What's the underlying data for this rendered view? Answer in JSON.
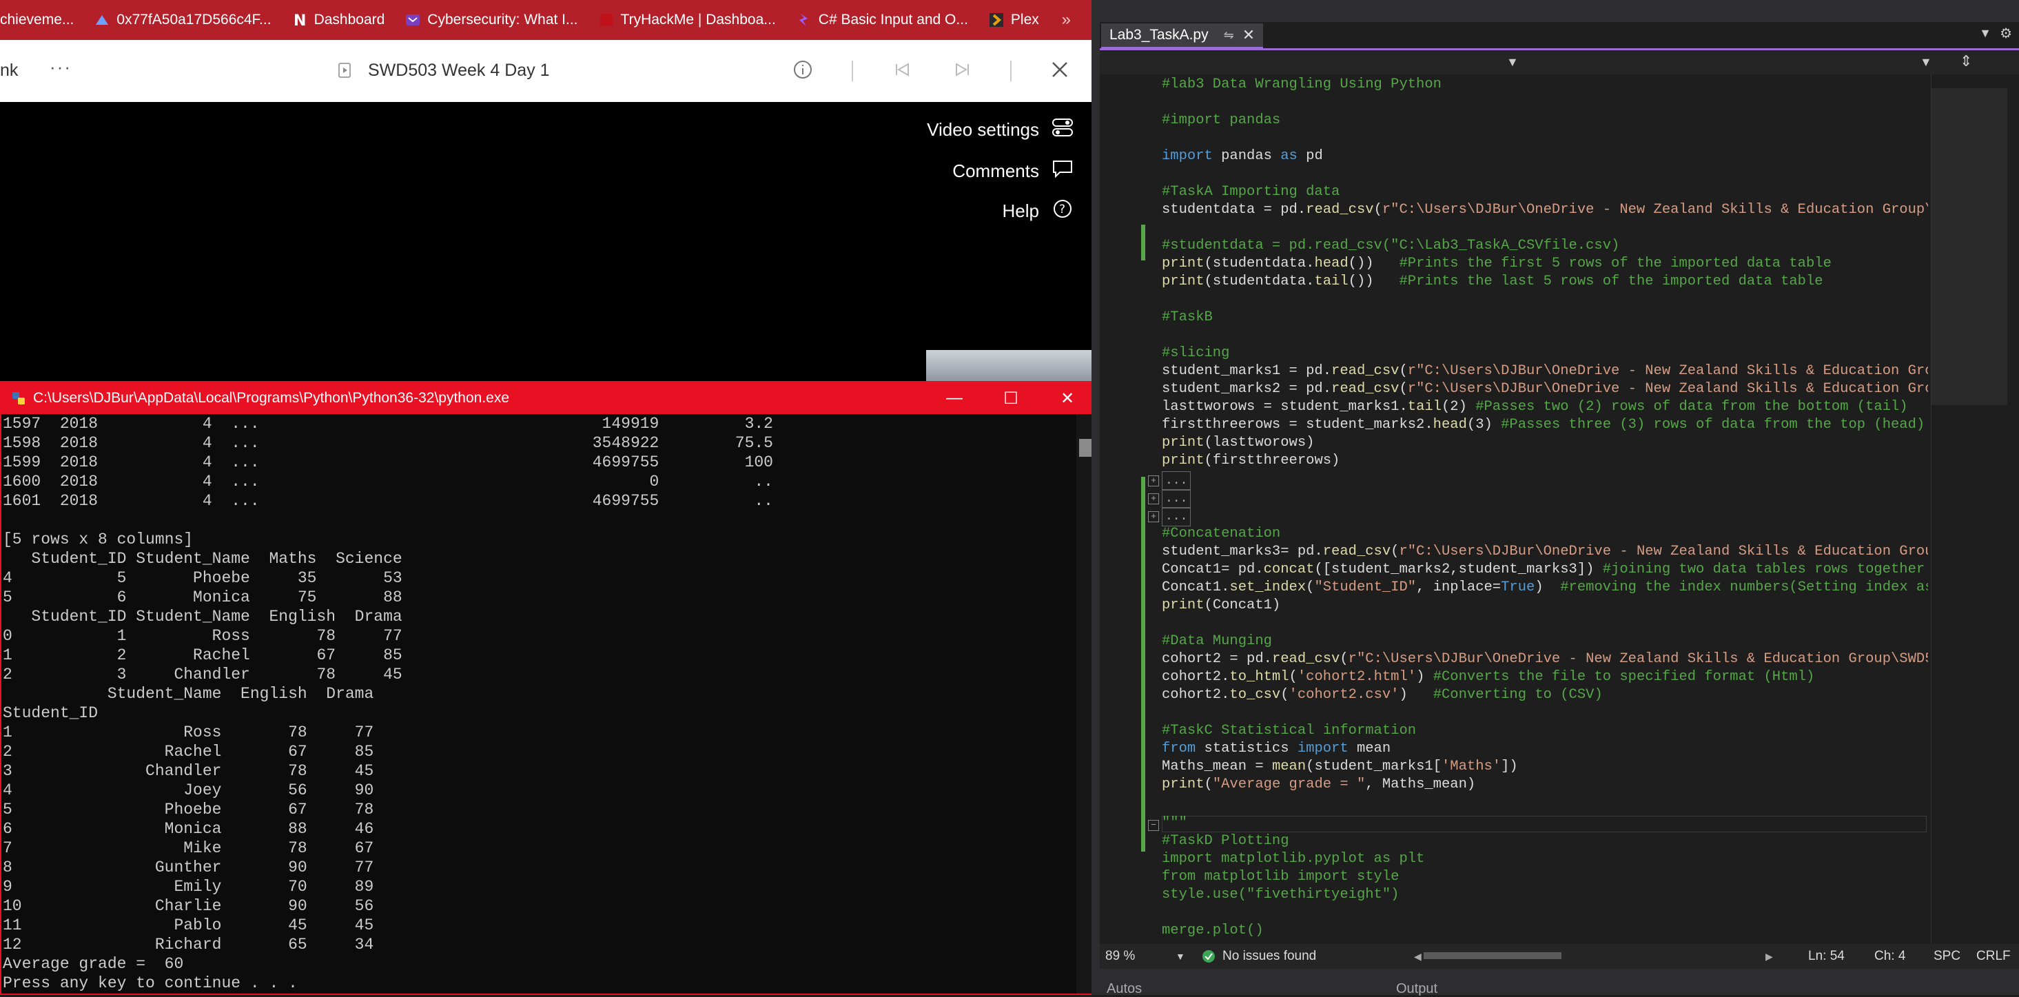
{
  "bookmarks": [
    {
      "label": "chieveme...",
      "icon": "bookmark-icon",
      "color": "#ffffff"
    },
    {
      "label": "0x77fA50a17D566c4F...",
      "icon": "wallet-icon",
      "color": "#5f8dff"
    },
    {
      "label": "Dashboard",
      "icon": "notion-icon",
      "color": "#ffffff"
    },
    {
      "label": "Cybersecurity: What I...",
      "icon": "course-icon",
      "color": "#7b3fbf"
    },
    {
      "label": "TryHackMe | Dashboa...",
      "icon": "tryhackme-icon",
      "color": "#c11"
    },
    {
      "label": "C# Basic Input and O...",
      "icon": "csharp-icon",
      "color": "#9b4dff"
    },
    {
      "label": "Plex",
      "icon": "plex-icon",
      "color": "#e5a00d"
    }
  ],
  "bookmarks_more": "»",
  "video_header": {
    "left_label": "nk",
    "more": "···",
    "title": "SWD503 Week 4 Day 1"
  },
  "video_menu": [
    {
      "label": "Video settings",
      "icon": "settings-toggle-icon"
    },
    {
      "label": "Comments",
      "icon": "comment-icon"
    },
    {
      "label": "Help",
      "icon": "help-icon"
    }
  ],
  "console": {
    "title": "C:\\Users\\DJBur\\AppData\\Local\\Programs\\Python\\Python36-32\\python.exe",
    "lines": [
      "1597  2018           4  ...                                    149919         3.2",
      "1598  2018           4  ...                                   3548922        75.5",
      "1599  2018           4  ...                                   4699755         100",
      "1600  2018           4  ...                                         0          ..",
      "1601  2018           4  ...                                   4699755          ..",
      "",
      "[5 rows x 8 columns]",
      "   Student_ID Student_Name  Maths  Science",
      "4           5       Phoebe     35       53",
      "5           6       Monica     75       88",
      "   Student_ID Student_Name  English  Drama",
      "0           1         Ross       78     77",
      "1           2       Rachel       67     85",
      "2           3     Chandler       78     45",
      "           Student_Name  English  Drama",
      "Student_ID",
      "1                  Ross       78     77",
      "2                Rachel       67     85",
      "3              Chandler       78     45",
      "4                  Joey       56     90",
      "5                Phoebe       67     78",
      "6                Monica       88     46",
      "7                  Mike       78     67",
      "8               Gunther       90     77",
      "9                 Emily       70     89",
      "10              Charlie       90     56",
      "11                Pablo       45     45",
      "12              Richard       65     34",
      "Average grade =  60",
      "Press any key to continue . . ."
    ]
  },
  "editor": {
    "tab_label": "Lab3_TaskA.py",
    "status": {
      "zoom": "89 %",
      "issues": "No issues found",
      "ln": "Ln: 54",
      "ch": "Ch: 4",
      "spc": "SPC",
      "crlf": "CRLF"
    },
    "bottom_left": "Autos",
    "bottom_right": "Output"
  }
}
